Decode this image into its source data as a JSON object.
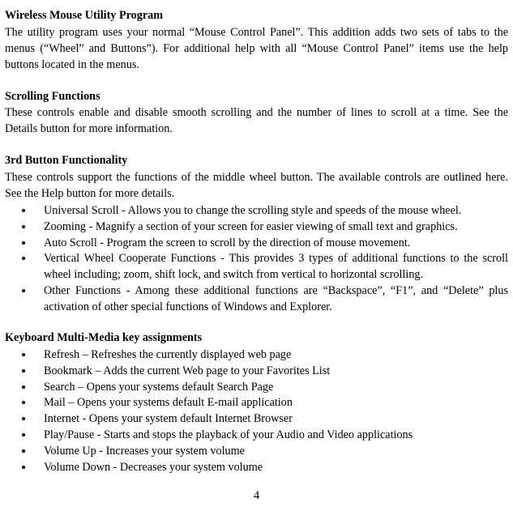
{
  "section1": {
    "heading": "Wireless Mouse Utility Program",
    "body": "The utility program uses your normal “Mouse Control Panel”. This addition adds two sets of tabs to the menus (“Wheel” and Buttons”). For additional help with all “Mouse Control Panel” items use the help buttons located in the menus."
  },
  "section2": {
    "heading": "Scrolling Functions",
    "body": "These controls enable and disable smooth scrolling and the number of lines to scroll at a time. See the Details button for more information."
  },
  "section3": {
    "heading": "3rd Button Functionality",
    "body": "These controls support the functions of the middle wheel button. The available controls are outlined here. See the Help button for more details.",
    "items": [
      "Universal Scroll  - Allows you to change the scrolling style and speeds of the mouse wheel.",
      "Zooming  - Magnify a section of your screen for easier viewing of small text and graphics.",
      "Auto Scroll  - Program the screen to scroll by the direction of mouse movement.",
      "Vertical Wheel Cooperate Functions - This provides 3 types of additional functions to the scroll wheel including; zoom, shift lock, and switch from vertical to horizontal scrolling.",
      "Other Functions  - Among these additional functions are “Backspace”, “F1”, and “Delete” plus activation of other special functions of Windows and Explorer."
    ]
  },
  "section4": {
    "heading": " Keyboard Multi-Media key assignments",
    "items": [
      "Refresh – Refreshes the currently displayed web page",
      "Bookmark – Adds the current Web page to your Favorites List",
      "Search – Opens your systems default Search Page",
      "Mail – Opens your systems default E-mail application",
      "Internet  - Opens your system default Internet Browser",
      "Play/Pause  - Starts and stops the playback of your Audio and Video applications",
      "Volume Up  - Increases your system volume",
      "Volume Down  - Decreases your system volume"
    ]
  },
  "pageNumber": "4"
}
